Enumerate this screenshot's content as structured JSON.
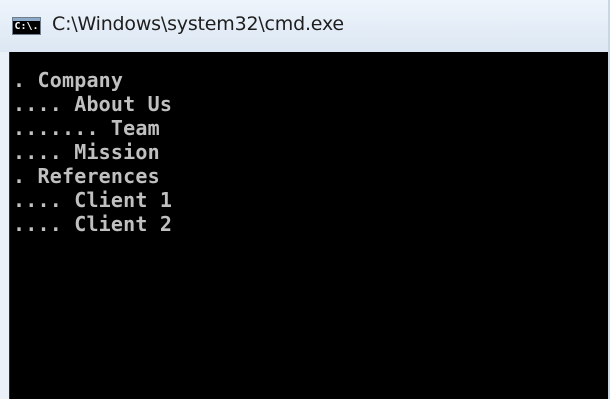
{
  "window": {
    "title": "C:\\Windows\\system32\\cmd.exe",
    "icon_label": "C:\\.",
    "icon_name": "cmd-console-icon"
  },
  "console": {
    "lines": [
      ". Company",
      ".... About Us",
      "....... Team",
      ".... Mission",
      ". References",
      ".... Client 1",
      ".... Client 2"
    ]
  },
  "colors": {
    "console_background": "#000000",
    "console_text": "#c0c0c0",
    "titlebar": "#e4edf7"
  }
}
